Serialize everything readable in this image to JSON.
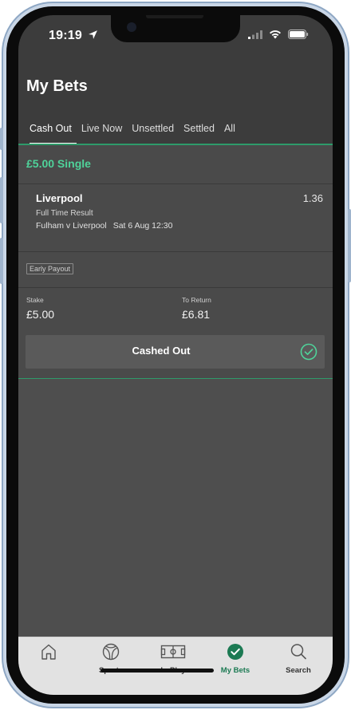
{
  "status_bar": {
    "time": "19:19",
    "icons": [
      "location-arrow-icon",
      "signal-icon",
      "wifi-icon",
      "battery-icon"
    ]
  },
  "header": {
    "title": "My Bets",
    "tabs": [
      {
        "label": "Cash Out",
        "active": true
      },
      {
        "label": "Live Now",
        "active": false
      },
      {
        "label": "Unsettled",
        "active": false
      },
      {
        "label": "Settled",
        "active": false
      },
      {
        "label": "All",
        "active": false
      }
    ]
  },
  "bet": {
    "title": "£5.00 Single",
    "selection": "Liverpool",
    "odds": "1.36",
    "market": "Full Time Result",
    "event": "Fulham v Liverpool",
    "date": "Sat 6 Aug 12:30",
    "badge": "Early Payout",
    "stake_label": "Stake",
    "stake_value": "£5.00",
    "return_label": "To Return",
    "return_value": "£6.81",
    "cashout_label": "Cashed Out"
  },
  "bottom_nav": {
    "items": [
      {
        "label": "",
        "icon": "home-icon",
        "active": false
      },
      {
        "label": "Sports",
        "icon": "football-icon",
        "active": false
      },
      {
        "label": "In-Play",
        "icon": "pitch-icon",
        "active": false
      },
      {
        "label": "My Bets",
        "icon": "check-circle-icon",
        "active": true
      },
      {
        "label": "Search",
        "icon": "search-icon",
        "active": false
      }
    ]
  },
  "colors": {
    "accent_green": "#4fd39a",
    "nav_active": "#1c7a53",
    "background": "#3c3c3c"
  }
}
